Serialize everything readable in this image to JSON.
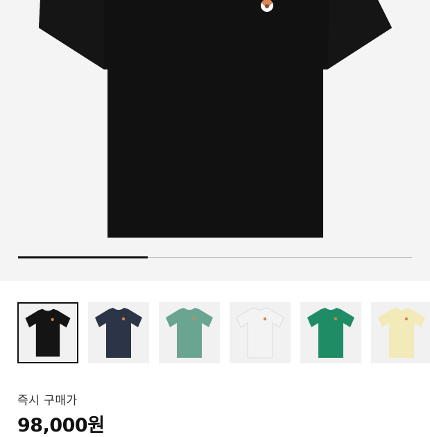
{
  "product": {
    "hero_image": "black-tshirt-front",
    "gallery_progress": 0.33,
    "colors": {
      "background": "#f4f4f4",
      "progress_track": "#bdbdbd",
      "progress_fill": "#111111"
    }
  },
  "thumbnails": [
    {
      "color_name": "black",
      "hex": "#141414",
      "selected": true
    },
    {
      "color_name": "navy",
      "hex": "#2c3547",
      "selected": false
    },
    {
      "color_name": "sage-green",
      "hex": "#6aa592",
      "selected": false
    },
    {
      "color_name": "white",
      "hex": "#f3f3f3",
      "selected": false
    },
    {
      "color_name": "green",
      "hex": "#1f8c66",
      "selected": false
    },
    {
      "color_name": "light-yellow",
      "hex": "#f3eab9",
      "selected": false
    }
  ],
  "price": {
    "label": "즉시 구매가",
    "value": "98,000원"
  }
}
